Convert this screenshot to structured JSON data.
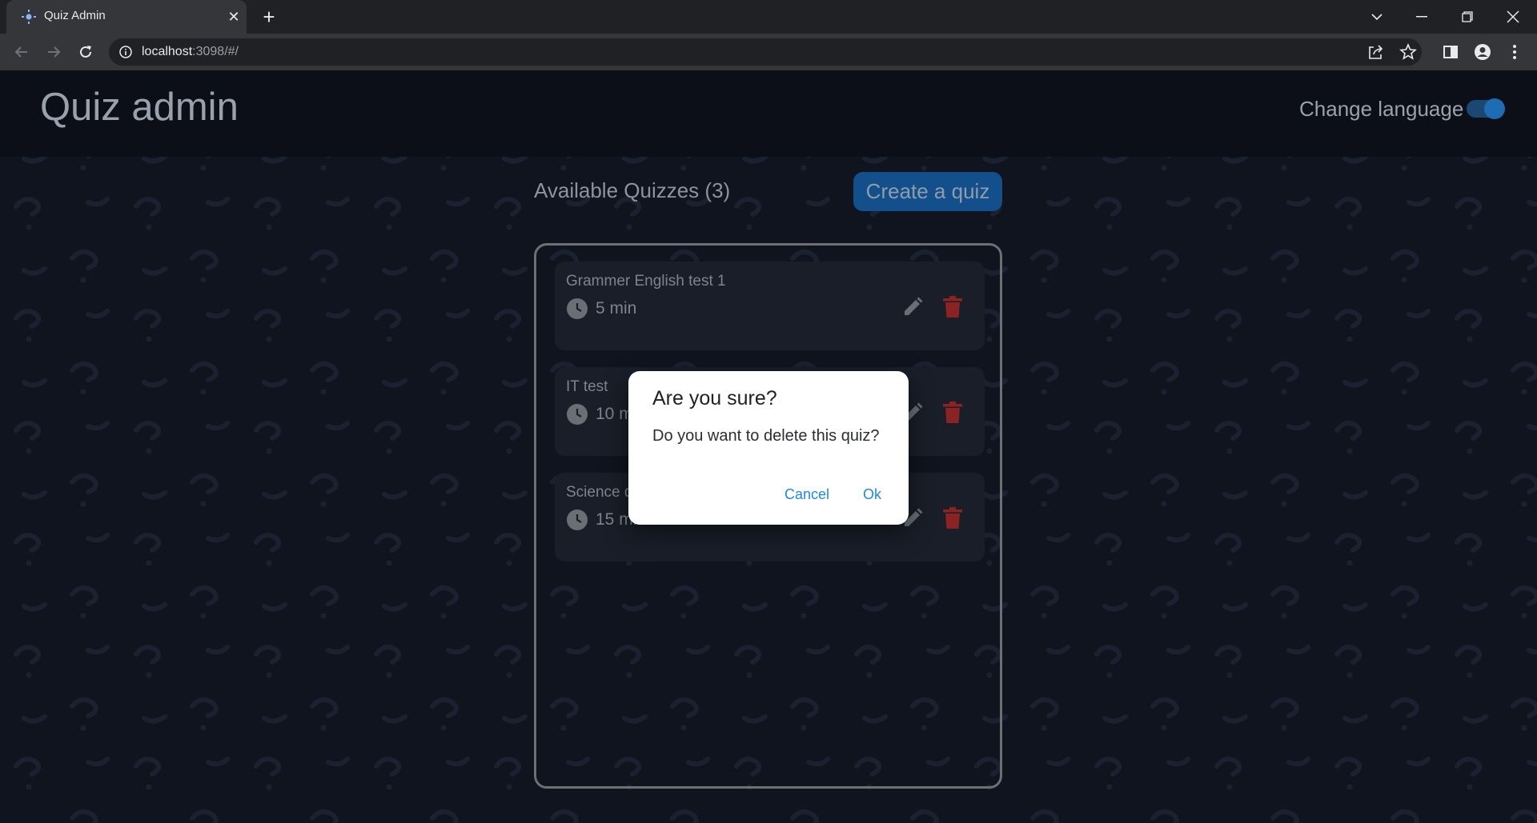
{
  "browser": {
    "tab_title": "Quiz Admin",
    "url_host": "localhost",
    "url_rest": ":3098/#/"
  },
  "header": {
    "title": "Quiz admin",
    "language_label": "Change language",
    "language_toggle_on": true
  },
  "main": {
    "available_label": "Available Quizzes (3)",
    "create_button": "Create a quiz",
    "quizzes": [
      {
        "name": "Grammer English test 1",
        "duration": "5 min"
      },
      {
        "name": "IT test",
        "duration": "10 min"
      },
      {
        "name": "Science quiz",
        "duration": "15 min"
      }
    ]
  },
  "dialog": {
    "title": "Are you sure?",
    "message": "Do you want to delete this quiz?",
    "cancel": "Cancel",
    "ok": "Ok"
  },
  "colors": {
    "accent": "#1e88e5",
    "delete": "#8b2323",
    "background": "#10141f"
  }
}
